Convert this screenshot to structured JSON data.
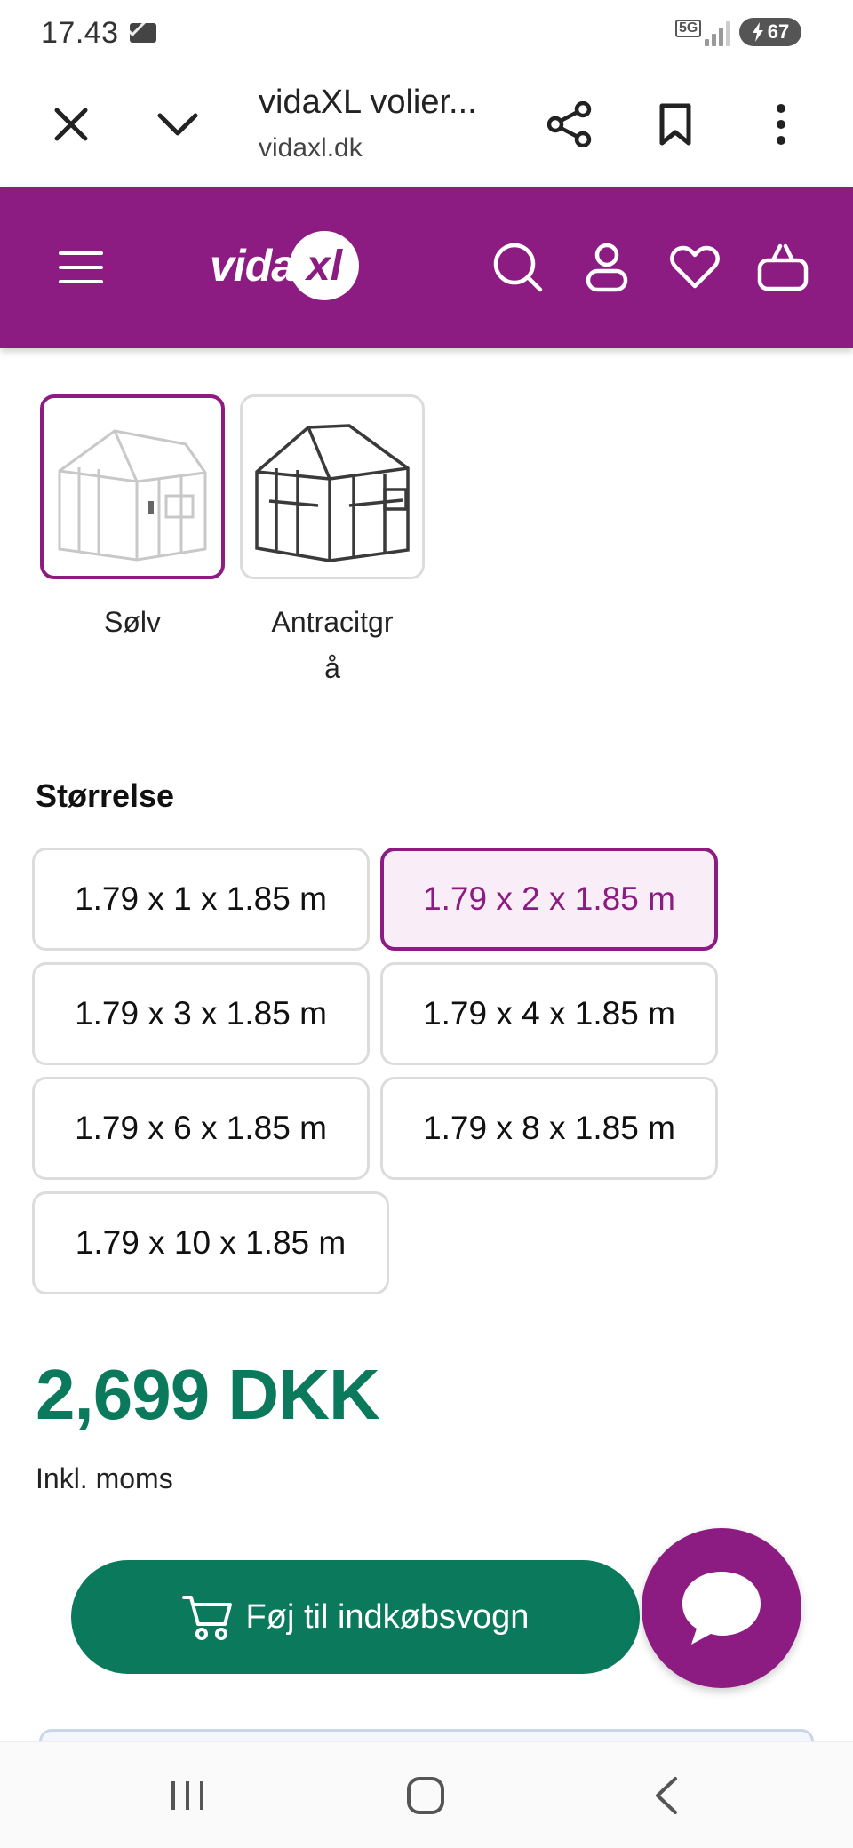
{
  "status_bar": {
    "time": "17.43",
    "network": "5G",
    "battery": "67"
  },
  "browser": {
    "title": "vidaXL volier...",
    "url": "vidaxl.dk"
  },
  "site_header": {
    "logo_text": "vida",
    "logo_badge": "xl",
    "brand_color": "#8c1b82"
  },
  "colors": {
    "options": [
      {
        "label": "Sølv",
        "selected": true
      },
      {
        "label_line1": "Antracitgr",
        "label_line2": "å",
        "selected": false
      }
    ]
  },
  "size": {
    "heading": "Størrelse",
    "options": [
      {
        "label": "1.79 x 1 x 1.85 m",
        "selected": false
      },
      {
        "label": "1.79 x 2 x 1.85 m",
        "selected": true
      },
      {
        "label": "1.79 x 3 x 1.85 m",
        "selected": false
      },
      {
        "label": "1.79 x 4 x 1.85 m",
        "selected": false
      },
      {
        "label": "1.79 x 6 x 1.85 m",
        "selected": false
      },
      {
        "label": "1.79 x 8 x 1.85 m",
        "selected": false
      },
      {
        "label": "1.79 x 10 x 1.85 m",
        "selected": false
      }
    ]
  },
  "price": {
    "amount": "2,699 DKK",
    "vat_note": "Inkl. moms",
    "color": "#0b7a5c"
  },
  "actions": {
    "add_to_cart": "Føj til indkøbsvogn"
  }
}
